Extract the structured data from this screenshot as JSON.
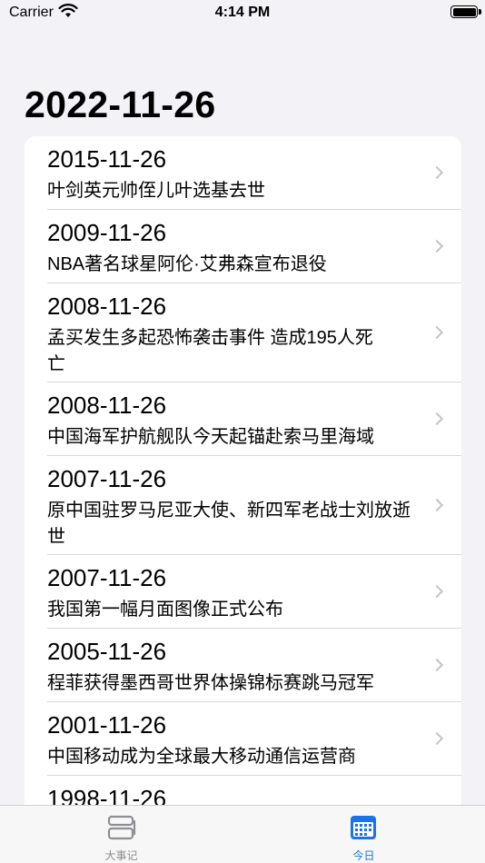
{
  "status_bar": {
    "carrier": "Carrier",
    "time": "4:14 PM",
    "icons": [
      "wifi-icon",
      "battery-icon"
    ]
  },
  "header": {
    "title": "2022-11-26"
  },
  "events": [
    {
      "date": "2015-11-26",
      "text": "叶剑英元帅侄儿叶选基去世"
    },
    {
      "date": "2009-11-26",
      "text": "NBA著名球星阿伦·艾弗森宣布退役"
    },
    {
      "date": "2008-11-26",
      "text": "孟买发生多起恐怖袭击事件 造成195人死亡"
    },
    {
      "date": "2008-11-26",
      "text": "中国海军护航舰队今天起锚赴索马里海域"
    },
    {
      "date": "2007-11-26",
      "text": "原中国驻罗马尼亚大使、新四军老战士刘放逝世"
    },
    {
      "date": "2007-11-26",
      "text": "我国第一幅月面图像正式公布"
    },
    {
      "date": "2005-11-26",
      "text": "程菲获得墨西哥世界体操锦标赛跳马冠军"
    },
    {
      "date": "2001-11-26",
      "text": "中国移动成为全球最大移动通信运营商"
    },
    {
      "date": "1998-11-26",
      "text": ""
    }
  ],
  "tab_bar": {
    "tabs": [
      {
        "label": "大事记",
        "icon": "events-icon",
        "selected": false
      },
      {
        "label": "今日",
        "icon": "calendar-icon",
        "selected": true
      }
    ],
    "colors": {
      "selected": "#1a73e8",
      "unselected": "#8e8e93"
    }
  }
}
